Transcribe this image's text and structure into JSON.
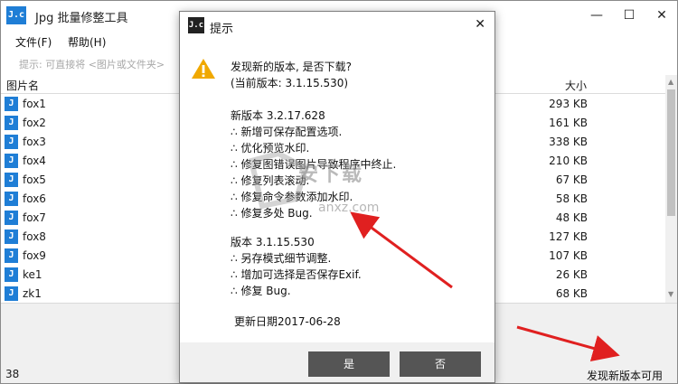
{
  "window": {
    "title": "Jpg 批量修整工具",
    "icon_text": "J.c",
    "controls": {
      "minimize": "—",
      "maximize": "☐",
      "close": "✕"
    }
  },
  "menu": {
    "file": "文件(F)",
    "help": "帮助(H)"
  },
  "hint": "提示: 可直接将 <图片或文件夹>",
  "list": {
    "headers": {
      "name": "图片名",
      "size": "大小"
    },
    "rows": [
      {
        "name": "fox1",
        "size": "293 KB"
      },
      {
        "name": "fox2",
        "size": "161 KB"
      },
      {
        "name": "fox3",
        "size": "338 KB"
      },
      {
        "name": "fox4",
        "size": "210 KB"
      },
      {
        "name": "fox5",
        "size": "67 KB"
      },
      {
        "name": "fox6",
        "size": "58 KB"
      },
      {
        "name": "fox7",
        "size": "48 KB"
      },
      {
        "name": "fox8",
        "size": "127 KB"
      },
      {
        "name": "fox9",
        "size": "107 KB"
      },
      {
        "name": "ke1",
        "size": "26 KB"
      },
      {
        "name": "zk1",
        "size": "68 KB"
      }
    ],
    "file_icon_text": "J"
  },
  "status": {
    "count": "38",
    "update_link": "发现新版本可用"
  },
  "dialog": {
    "title": "提示",
    "icon_text": "J.c",
    "close": "✕",
    "lines": {
      "question": "发现新的版本, 是否下载?",
      "current": "(当前版本: 3.1.15.530)",
      "new_version": "新版本 3.2.17.628",
      "new_items": [
        "∴ 新增可保存配置选项.",
        "∴ 优化预览水印.",
        "∴ 修复图错误图片导致程序中终止.",
        "∴ 修复列表滚动.",
        "∴ 修复命令参数添加水印.",
        "∴ 修复多处 Bug."
      ],
      "old_version": "版本 3.1.15.530",
      "old_items": [
        "∴ 另存模式细节调整.",
        "∴ 增加可选择是否保存Exif.",
        "∴ 修复 Bug."
      ],
      "date": "更新日期2017-06-28"
    },
    "buttons": {
      "yes": "是",
      "no": "否"
    }
  },
  "watermark": {
    "text": "安下载",
    "sub": "anxz.com"
  },
  "colors": {
    "accent": "#1f7ed6",
    "button": "#555555",
    "arrow": "#e02020",
    "warning": "#f0a800"
  }
}
